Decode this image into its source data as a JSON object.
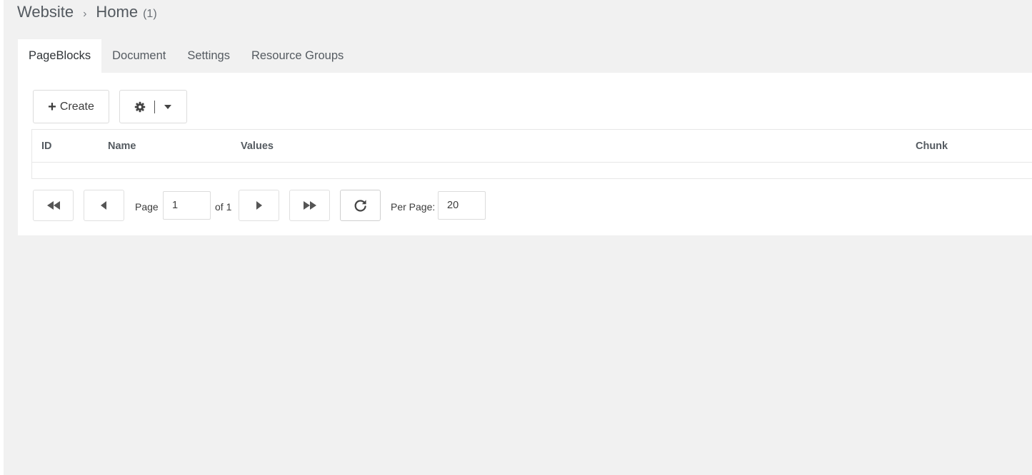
{
  "breadcrumb": {
    "root": "Website",
    "separator": "›",
    "current": "Home",
    "count": "(1)"
  },
  "tabs": [
    {
      "label": "PageBlocks",
      "active": true
    },
    {
      "label": "Document",
      "active": false
    },
    {
      "label": "Settings",
      "active": false
    },
    {
      "label": "Resource Groups",
      "active": false
    }
  ],
  "toolbar": {
    "create_icon": "plus-icon",
    "create_label": "Create",
    "settings_icon": "gear-icon",
    "dropdown_icon": "caret-down-icon"
  },
  "grid": {
    "columns": [
      "ID",
      "Name",
      "Values",
      "Chunk"
    ],
    "rows": []
  },
  "pager": {
    "first_icon": "double-left-icon",
    "prev_icon": "triangle-left-icon",
    "next_icon": "triangle-right-icon",
    "last_icon": "double-right-icon",
    "refresh_icon": "refresh-icon",
    "page_label": "Page",
    "page_value": "1",
    "of_label": "of 1",
    "per_page_label": "Per Page:",
    "per_page_value": "20"
  },
  "colors": {
    "background": "#f1f1f1",
    "panel": "#ffffff",
    "border": "#e7e7e7",
    "text": "#3c3c3c"
  }
}
